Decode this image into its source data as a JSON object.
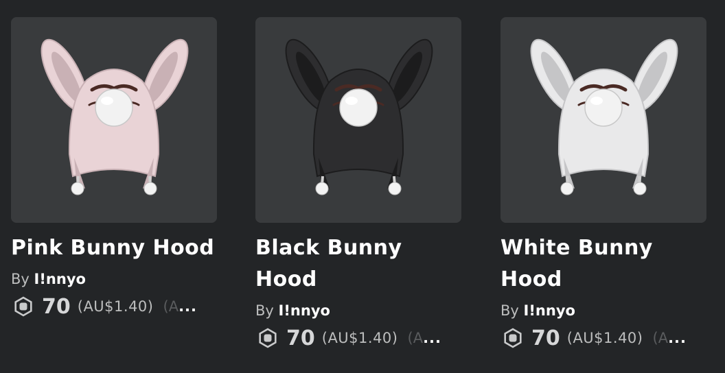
{
  "items": [
    {
      "name": "Pink Bunny Hood",
      "by_prefix": "By",
      "creator": "I!nnyo",
      "price": "70",
      "local_price": "(AU$1.40)",
      "truncated_prefix": "(A",
      "truncated_ellipsis": "...",
      "hood_color": "#e9d3d6",
      "hood_shade": "#c9b1b5"
    },
    {
      "name": "Black Bunny Hood",
      "by_prefix": "By",
      "creator": "I!nnyo",
      "price": "70",
      "local_price": "(AU$1.40)",
      "truncated_prefix": "(A",
      "truncated_ellipsis": "...",
      "hood_color": "#2d2d2f",
      "hood_shade": "#1c1c1d"
    },
    {
      "name": "White Bunny Hood",
      "by_prefix": "By",
      "creator": "I!nnyo",
      "price": "70",
      "local_price": "(AU$1.40)",
      "truncated_prefix": "(A",
      "truncated_ellipsis": "...",
      "hood_color": "#e9e9ea",
      "hood_shade": "#c5c5c7"
    }
  ],
  "icons": {
    "currency": "robux-icon"
  }
}
